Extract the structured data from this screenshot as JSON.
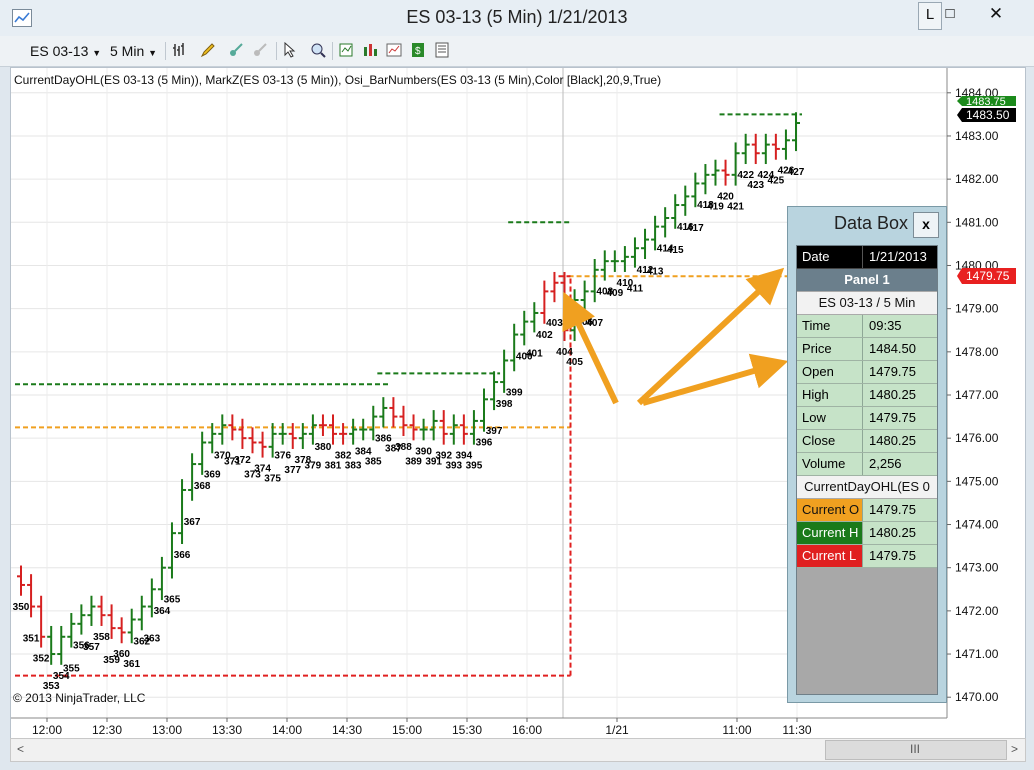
{
  "window": {
    "title": "ES 03-13 (5 Min)  1/21/2013",
    "controls": {
      "layout": "L",
      "maximize": "□",
      "close": "✕"
    }
  },
  "toolbar": {
    "instrument": "ES 03-13",
    "interval": "5 Min",
    "icons": [
      "bar-type-icon",
      "pencil-icon",
      "draw-icon",
      "draw-disabled-icon",
      "cursor-icon",
      "zoom-icon",
      "indicators-icon",
      "strategy-icon",
      "chart-properties-icon",
      "data-series-icon",
      "data-box-icon"
    ]
  },
  "chart": {
    "indicator_text": "CurrentDayOHL(ES 03-13 (5 Min)),  MarkZ(ES 03-13 (5 Min)),  Osi_BarNumbers(ES 03-13 (5 Min),Color [Black],20,9,True)",
    "copyright": "© 2013 NinjaTrader, LLC",
    "price_labels": {
      "ask": "1483.75",
      "last": "1483.50",
      "current_open": "1479.75"
    }
  },
  "chart_data": {
    "type": "ohlc",
    "title": "",
    "xlabel": "",
    "ylabel": "",
    "ylim": [
      1469.75,
      1484.25
    ],
    "y_ticks": [
      "1470.00",
      "1471.00",
      "1472.00",
      "1473.00",
      "1474.00",
      "1475.00",
      "1476.00",
      "1477.00",
      "1478.00",
      "1479.00",
      "1480.00",
      "1481.00",
      "1482.00",
      "1483.00",
      "1484.00"
    ],
    "x_ticks": [
      "12:00",
      "12:30",
      "13:00",
      "13:30",
      "14:00",
      "14:30",
      "15:00",
      "15:30",
      "16:00",
      "1/21",
      "11:00",
      "11:30"
    ],
    "grid": true,
    "bars": {
      "numbers": [
        350,
        351,
        352,
        353,
        354,
        355,
        356,
        357,
        358,
        359,
        360,
        361,
        362,
        363,
        364,
        365,
        366,
        367,
        368,
        369,
        370,
        371,
        372,
        373,
        374,
        375,
        376,
        377,
        378,
        379,
        380,
        381,
        382,
        383,
        384,
        385,
        386,
        387,
        388,
        389,
        390,
        391,
        392,
        393,
        394,
        395,
        396,
        397,
        398,
        399,
        400,
        401,
        402,
        403,
        404,
        405,
        406,
        407,
        408,
        409,
        410,
        411,
        412,
        413,
        414,
        415,
        416,
        417,
        418,
        419,
        420,
        421,
        422,
        423,
        424,
        425,
        426,
        427
      ],
      "close": [
        1472.6,
        1472.1,
        1471.4,
        1471.0,
        1471.4,
        1471.7,
        1471.9,
        1472.1,
        1471.9,
        1471.6,
        1471.5,
        1471.8,
        1472.1,
        1472.5,
        1473.0,
        1473.8,
        1474.8,
        1475.4,
        1475.9,
        1476.1,
        1476.3,
        1476.2,
        1476.0,
        1475.9,
        1475.8,
        1476.1,
        1476.1,
        1476.0,
        1476.1,
        1476.3,
        1476.3,
        1476.1,
        1476.1,
        1476.2,
        1476.2,
        1476.5,
        1476.7,
        1476.5,
        1476.3,
        1476.2,
        1476.2,
        1476.4,
        1476.1,
        1476.3,
        1476.1,
        1476.4,
        1476.9,
        1477.3,
        1477.8,
        1478.4,
        1478.7,
        1478.9,
        1479.4,
        1479.6,
        1478.5,
        1479.2,
        1479.4,
        1479.9,
        1480.1,
        1480.1,
        1480.2,
        1480.4,
        1480.6,
        1480.9,
        1481.1,
        1481.4,
        1481.6,
        1481.9,
        1482.1,
        1482.2,
        1482.1,
        1482.6,
        1482.8,
        1482.6,
        1482.8,
        1482.7,
        1482.9,
        1483.3
      ],
      "up": [
        false,
        false,
        false,
        true,
        true,
        true,
        true,
        true,
        false,
        false,
        false,
        true,
        true,
        true,
        true,
        true,
        true,
        true,
        true,
        true,
        true,
        false,
        false,
        false,
        false,
        true,
        true,
        false,
        true,
        true,
        false,
        false,
        false,
        true,
        true,
        true,
        true,
        false,
        false,
        false,
        true,
        true,
        false,
        true,
        false,
        true,
        true,
        true,
        true,
        true,
        true,
        true,
        false,
        false,
        false,
        true,
        true,
        true,
        true,
        true,
        true,
        true,
        true,
        true,
        true,
        true,
        true,
        true,
        true,
        true,
        false,
        true,
        true,
        false,
        true,
        false,
        true,
        true
      ]
    },
    "series": [
      {
        "name": "Current O",
        "color": "#f0a020",
        "segments": [
          {
            "from": 350,
            "to": 404,
            "value": 1476.25
          },
          {
            "from": 405,
            "to": 427,
            "value": 1479.75
          }
        ]
      },
      {
        "name": "Current H",
        "color": "#1a7a1a",
        "segments": [
          {
            "from": 350,
            "to": 386,
            "value": 1477.25
          },
          {
            "from": 386,
            "to": 397,
            "value": 1477.5
          },
          {
            "from": 399,
            "to": 404,
            "value": 1481.0
          },
          {
            "from": 420,
            "to": 427,
            "value": 1483.5
          }
        ]
      },
      {
        "name": "Current L",
        "color": "#e02020",
        "segments": [
          {
            "from": 350,
            "to": 404,
            "value": 1470.5
          },
          {
            "from": 404,
            "to": 404,
            "value": 1479.75
          }
        ]
      }
    ]
  },
  "databox": {
    "title": "Data Box",
    "close": "x",
    "date_label": "Date",
    "date_value": "1/21/2013",
    "panel": "Panel 1",
    "series_header": "ES 03-13 / 5 Min",
    "rows": [
      {
        "label": "Time",
        "value": "09:35"
      },
      {
        "label": "Price",
        "value": "1484.50"
      },
      {
        "label": "Open",
        "value": "1479.75"
      },
      {
        "label": "High",
        "value": "1480.25"
      },
      {
        "label": "Low",
        "value": "1479.75"
      },
      {
        "label": "Close",
        "value": "1480.25"
      },
      {
        "label": "Volume",
        "value": "2,256"
      }
    ],
    "indicator_header": "CurrentDayOHL(ES 0",
    "indicator_rows": [
      {
        "label": "Current O",
        "value": "1479.75",
        "color": "#f0a020"
      },
      {
        "label": "Current H",
        "value": "1480.25",
        "color": "#1a7a1a"
      },
      {
        "label": "Current L",
        "value": "1479.75",
        "color": "#e02020"
      }
    ]
  },
  "scrollbar": {
    "left_arrow": "<",
    "right_arrow": ">",
    "grip": "III"
  }
}
